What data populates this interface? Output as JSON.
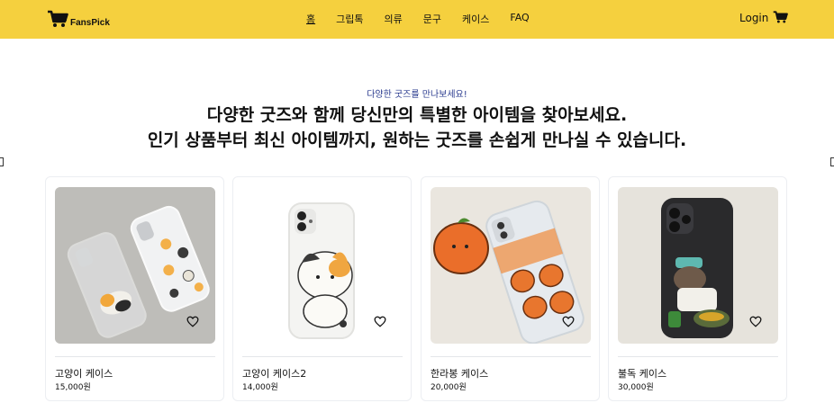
{
  "header": {
    "logo_text": "FansPick",
    "nav": [
      {
        "label": "홈",
        "active": true
      },
      {
        "label": "그립톡",
        "active": false
      },
      {
        "label": "의류",
        "active": false
      },
      {
        "label": "문구",
        "active": false
      },
      {
        "label": "케이스",
        "active": false
      },
      {
        "label": "FAQ",
        "active": false
      }
    ],
    "login_label": "Login",
    "accent_color": "#f5d03e"
  },
  "hero": {
    "subtitle": "다양한 굿즈를 만나보세요!",
    "line1": "다양한 굿즈와 함께 당신만의 특별한 아이템을 찾아보세요.",
    "line2": "인기 상품부터 최신 아이템까지, 원하는 굿즈를 손쉽게 만나실 수 있습니다."
  },
  "products": [
    {
      "name": "고양이 케이스",
      "price": "15,000원",
      "image": "clear-cat-phone-cases"
    },
    {
      "name": "고양이 케이스2",
      "price": "14,000원",
      "image": "white-cat-phone-case"
    },
    {
      "name": "한라봉 케이스",
      "price": "20,000원",
      "image": "hallabong-orange-phone-case"
    },
    {
      "name": "불독 케이스",
      "price": "30,000원",
      "image": "bulldog-phone-case"
    }
  ]
}
